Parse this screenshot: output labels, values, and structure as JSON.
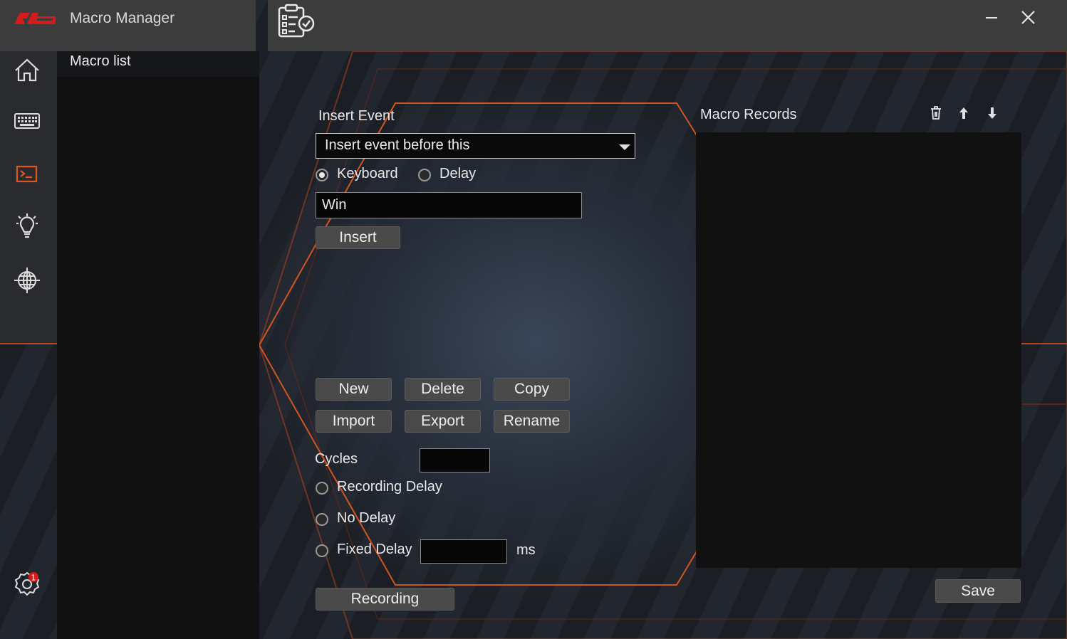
{
  "app": {
    "title": "Macro Manager",
    "accent_color": "#e0561c",
    "logo_icon": "rog-logo-icon",
    "page_icon": "clipboard-check-icon"
  },
  "window_controls": {
    "minimize_icon": "minimize-icon",
    "close_icon": "close-icon"
  },
  "nav": {
    "items": [
      {
        "name": "home",
        "icon": "home-icon",
        "active": false
      },
      {
        "name": "keyboard",
        "icon": "keyboard-icon",
        "active": false
      },
      {
        "name": "macro",
        "icon": "terminal-icon",
        "active": true
      },
      {
        "name": "lighting",
        "icon": "lightbulb-icon",
        "active": false
      },
      {
        "name": "network",
        "icon": "globe-icon",
        "active": false
      }
    ],
    "settings": {
      "icon": "settings-gear-icon",
      "badge": "1"
    }
  },
  "macro_list": {
    "title": "Macro list",
    "items": []
  },
  "insert_event": {
    "title": "Insert Event",
    "position_select": "Insert event before this",
    "type_options": [
      {
        "label": "Keyboard",
        "selected": true
      },
      {
        "label": "Delay",
        "selected": false
      }
    ],
    "key_value": "Win",
    "insert_label": "Insert"
  },
  "actions": {
    "new": "New",
    "delete": "Delete",
    "copy": "Copy",
    "import": "Import",
    "export": "Export",
    "rename": "Rename"
  },
  "playback": {
    "cycles_label": "Cycles",
    "cycles_value": "",
    "delay_options": [
      {
        "label": "Recording Delay",
        "selected": false
      },
      {
        "label": "No Delay",
        "selected": false
      },
      {
        "label": "Fixed Delay",
        "selected": false
      }
    ],
    "fixed_delay_value": "",
    "fixed_delay_unit": "ms",
    "recording_label": "Recording"
  },
  "records": {
    "title": "Macro Records",
    "tools": [
      "trash-icon",
      "arrow-up-icon",
      "arrow-down-icon"
    ],
    "items": [],
    "save_label": "Save"
  }
}
